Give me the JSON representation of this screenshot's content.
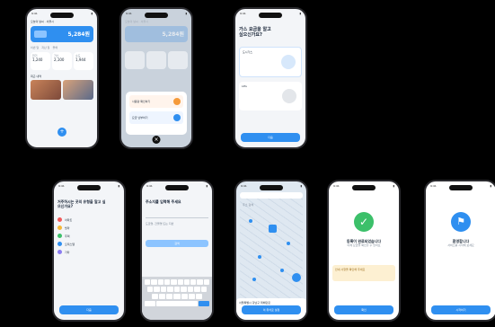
{
  "colors": {
    "accent": "#2f8ff0",
    "success": "#3cc06a",
    "warn": "#f59a3a",
    "background": "#000000"
  },
  "status_bar": {
    "time": "9:41"
  },
  "phones": {
    "p1": {
      "header": "오늘의 날씨 · 서울시",
      "big_value": "5,284원",
      "tabs": [
        "이번 달",
        "지난 달",
        "올해"
      ],
      "stats": [
        {
          "label": "전기",
          "value": "1,240"
        },
        {
          "label": "가스",
          "value": "2,100"
        },
        {
          "label": "수도",
          "value": "1,944"
        }
      ],
      "section": "최근 내역",
      "fab": "+"
    },
    "p2": {
      "header": "오늘의 날씨 · 서울시",
      "big_value": "5,284원",
      "sheet_items": [
        {
          "label": "사용량 확인하기",
          "icon": "chart-icon"
        },
        {
          "label": "요금 납부하기",
          "icon": "card-icon"
        }
      ],
      "close": "×"
    },
    "p3": {
      "question": "가스 요금을 알고 싶으신가요?",
      "option_a": "도시가스",
      "option_b": "LPG",
      "button": "다음"
    },
    "p4": {
      "question": "거주하시는 곳의 유형을 알고 싶으신가요?",
      "options": [
        {
          "label": "아파트",
          "color": "#f25a5a"
        },
        {
          "label": "빌라",
          "color": "#f5b83a"
        },
        {
          "label": "주택",
          "color": "#3cc06a"
        },
        {
          "label": "오피스텔",
          "color": "#2f8ff0"
        },
        {
          "label": "기타",
          "color": "#8a7cf0"
        }
      ],
      "button": "다음"
    },
    "p5": {
      "question": "주소지를 입력해 주세요",
      "placeholder": "도로명, 건물명 또는 지번",
      "button": "검색",
      "keyboard_rows": [
        10,
        9,
        7
      ]
    },
    "p6": {
      "search": "주소 검색",
      "bottom_label": "서울특별시 강남구 테헤란로",
      "button": "이 위치로 설정"
    },
    "p7": {
      "title": "등록이 완료되었습니다",
      "subtitle": "이제 요금을 확인할 수 있어요",
      "notice": "안내 사항을 확인해 주세요",
      "button": "확인"
    },
    "p8": {
      "title": "환영합니다",
      "subtitle": "서비스를 시작해 보세요",
      "button": "시작하기"
    }
  }
}
